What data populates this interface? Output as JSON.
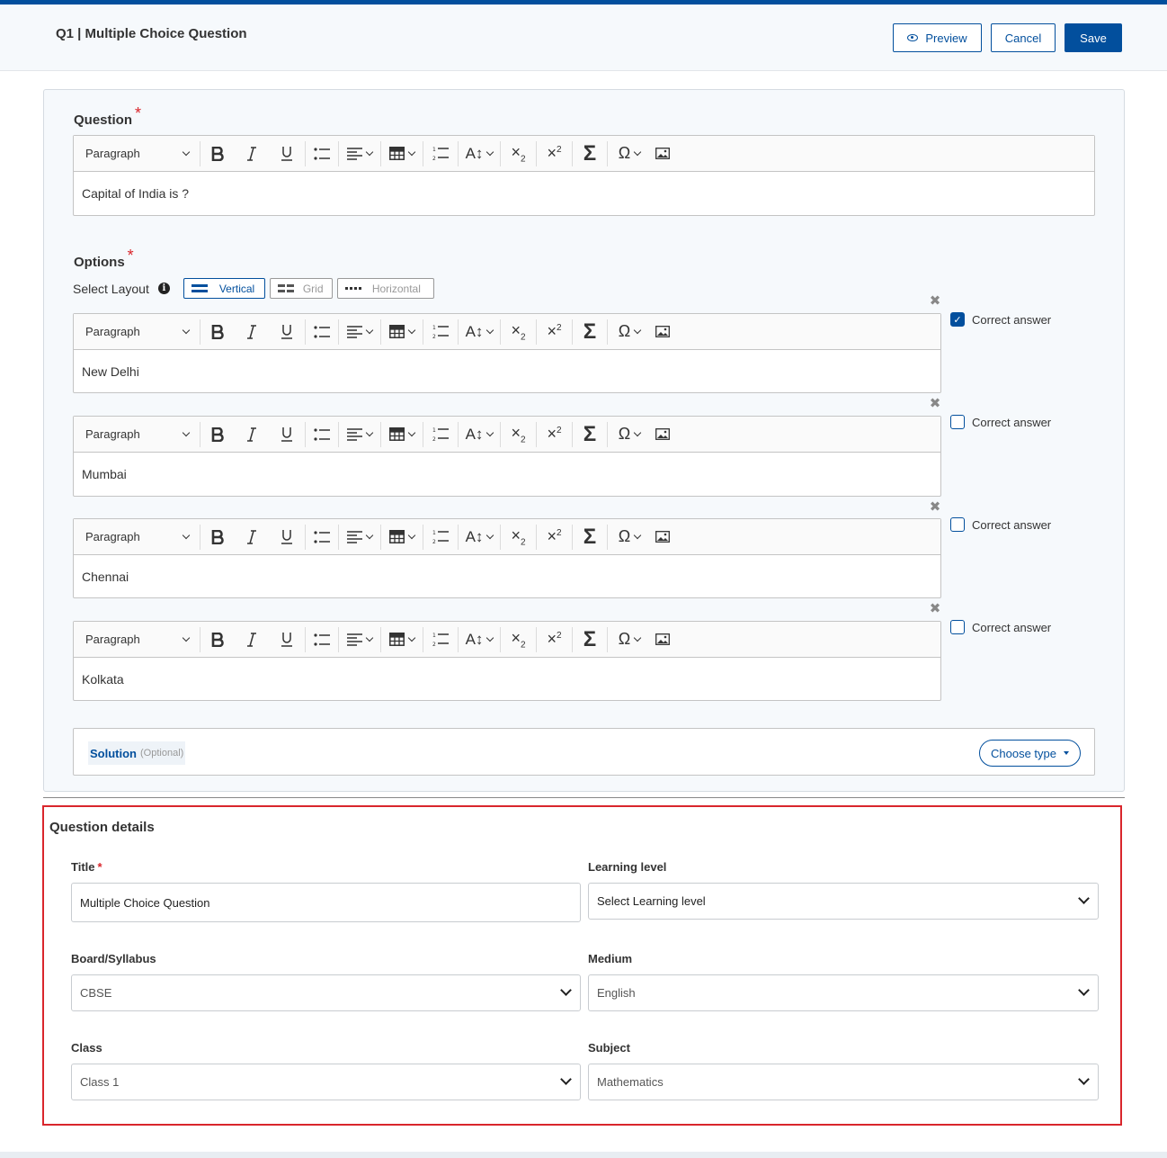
{
  "header": {
    "title": "Q1 | Multiple Choice Question",
    "preview_label": "Preview",
    "cancel_label": "Cancel",
    "save_label": "Save"
  },
  "toolbar": {
    "paragraph_label": "Paragraph"
  },
  "question": {
    "label": "Question",
    "required_mark": "*",
    "text": "Capital of India is ?"
  },
  "options": {
    "label": "Options",
    "required_mark": "*",
    "layout_label": "Select Layout",
    "layouts": [
      "Vertical",
      "Grid",
      "Horizontal"
    ],
    "selected_layout": "Vertical",
    "correct_answer_label": "Correct answer",
    "items": [
      {
        "text": "New Delhi",
        "correct": true
      },
      {
        "text": "Mumbai",
        "correct": false
      },
      {
        "text": "Chennai",
        "correct": false
      },
      {
        "text": "Kolkata",
        "correct": false
      }
    ]
  },
  "solution": {
    "label": "Solution",
    "optional_label": "(Optional)",
    "choose_type_label": "Choose type"
  },
  "details": {
    "heading": "Question details",
    "title_label": "Title",
    "title_required_mark": "*",
    "title_value": "Multiple Choice Question",
    "learning_level_label": "Learning level",
    "learning_level_value": "Select Learning level",
    "board_label": "Board/Syllabus",
    "board_value": "CBSE",
    "medium_label": "Medium",
    "medium_value": "English",
    "class_label": "Class",
    "class_value": "Class 1",
    "subject_label": "Subject",
    "subject_value": "Mathematics"
  },
  "colors": {
    "brand": "#024f9d",
    "required": "#d9262c",
    "highlight_border": "#d9262c"
  }
}
